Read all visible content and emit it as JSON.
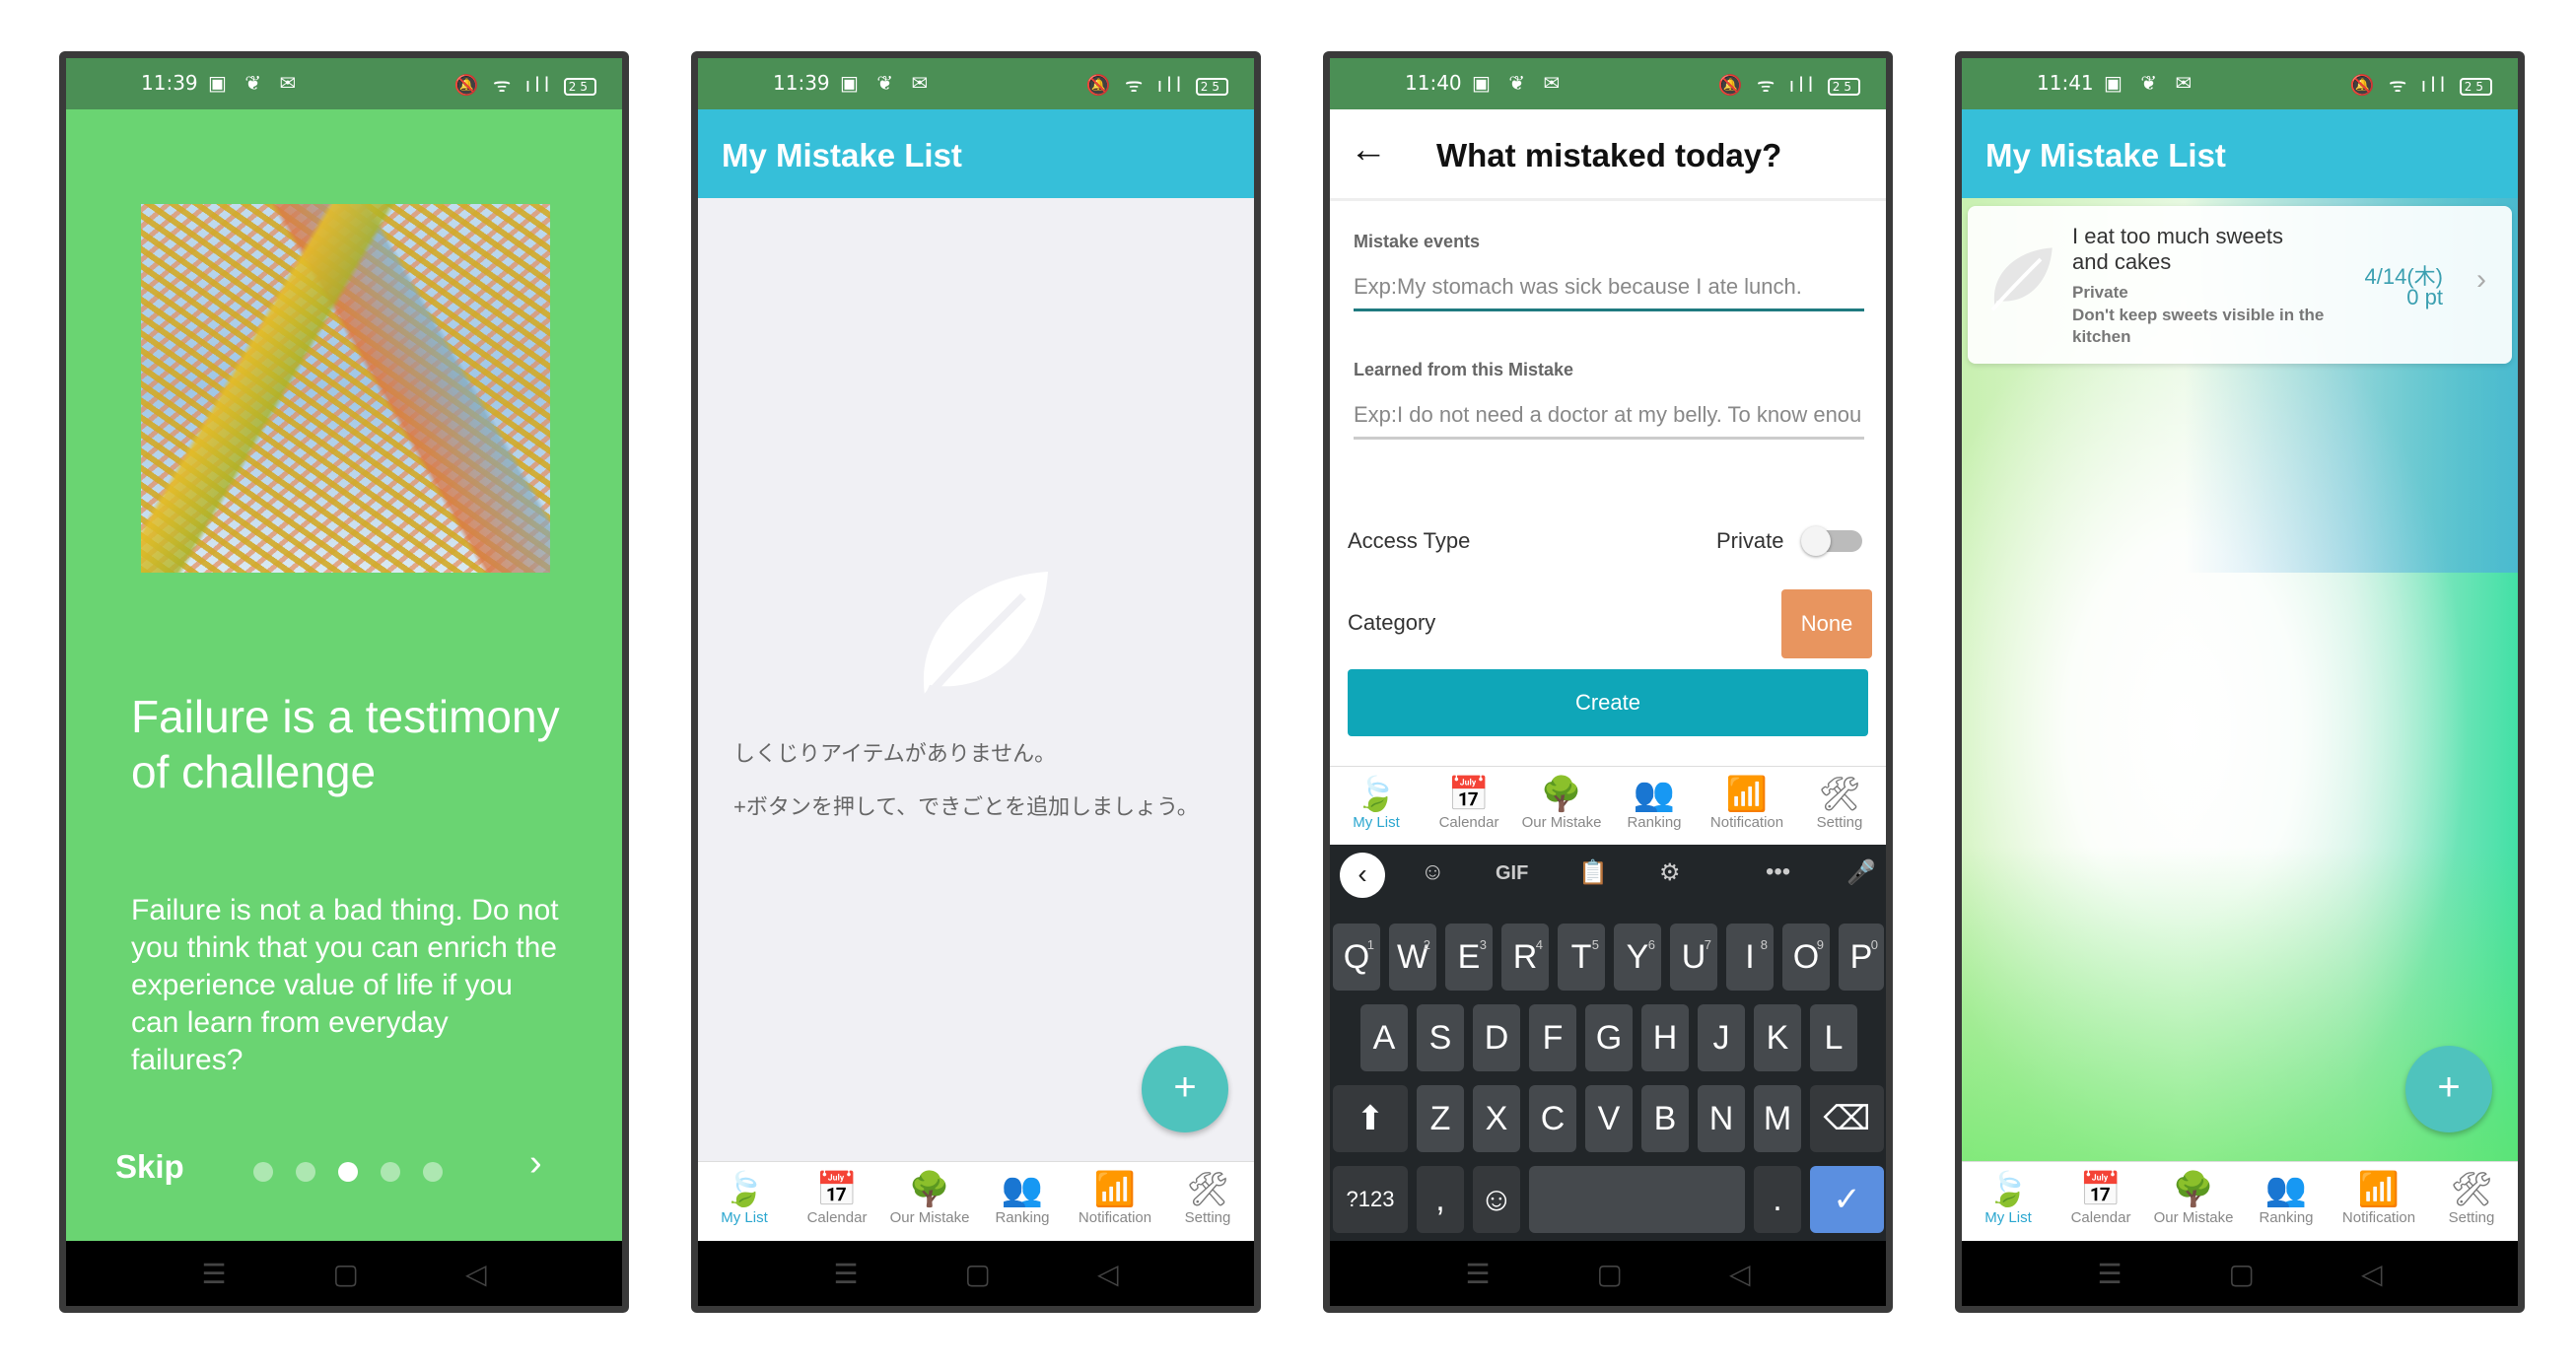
{
  "status": {
    "times": [
      "11:39",
      "11:39",
      "11:40",
      "11:41"
    ],
    "left_icons": "▣ ❦ ✉",
    "right_icons": "🔕 ᯤ ıll",
    "battery": "25"
  },
  "onboarding": {
    "title": "Failure is a testimony of challenge",
    "body": "Failure is not a bad thing. Do not you think that you can enrich the experience value of life if you can learn from everyday failures?",
    "skip_label": "Skip",
    "next_glyph": "›",
    "page_count": 5,
    "active_page": 3
  },
  "list_screen": {
    "title": "My Mistake List",
    "empty_line1": "しくじりアイテムがありません。",
    "empty_line2": "+ボタンを押して、できごとを追加しましょう。",
    "fab_label": "+"
  },
  "tabs": [
    {
      "label": "My List",
      "icon": "leaf-icon",
      "glyph": "🍃"
    },
    {
      "label": "Calendar",
      "icon": "calendar-icon",
      "glyph": "📅"
    },
    {
      "label": "Our Mistake",
      "icon": "tree-icon",
      "glyph": "🌳"
    },
    {
      "label": "Ranking",
      "icon": "people-icon",
      "glyph": "👥"
    },
    {
      "label": "Notification",
      "icon": "wifi-icon",
      "glyph": "📶"
    },
    {
      "label": "Setting",
      "icon": "tools-icon",
      "glyph": "🛠"
    }
  ],
  "form_screen": {
    "title": "What mistaked today?",
    "back_glyph": "←",
    "mistake_label": "Mistake events",
    "mistake_placeholder": "Exp:My stomach was sick because I ate lunch.",
    "learned_label": "Learned from this Mistake",
    "learned_placeholder": "Exp:I do not need a doctor at my belly. To know enou",
    "access_label": "Access Type",
    "access_value": "Private",
    "category_label": "Category",
    "category_value": "None",
    "create_label": "Create"
  },
  "keyboard": {
    "toolbar": [
      "‹",
      "☺",
      "GIF",
      "📋",
      "⚙",
      "•••",
      "🎤"
    ],
    "row1": [
      [
        "Q",
        "1"
      ],
      [
        "W",
        "2"
      ],
      [
        "E",
        "3"
      ],
      [
        "R",
        "4"
      ],
      [
        "T",
        "5"
      ],
      [
        "Y",
        "6"
      ],
      [
        "U",
        "7"
      ],
      [
        "I",
        "8"
      ],
      [
        "O",
        "9"
      ],
      [
        "P",
        "0"
      ]
    ],
    "row2": [
      "A",
      "S",
      "D",
      "F",
      "G",
      "H",
      "J",
      "K",
      "L"
    ],
    "row3": [
      "Z",
      "X",
      "C",
      "V",
      "B",
      "N",
      "M"
    ],
    "shift": "⬆",
    "backspace": "⌫",
    "symbols": "?123",
    "comma": ",",
    "emoji": "☺",
    "period": ".",
    "enter": "✓"
  },
  "filled_list": {
    "title": "My Mistake List",
    "item": {
      "title": "I eat too much sweets and cakes",
      "access": "Private",
      "learned": "Don't keep sweets visible in the kitchen",
      "date": "4/14(木)",
      "points": "0 pt"
    },
    "fab_label": "+"
  },
  "nav_glyphs": [
    "☰",
    "▢",
    "◁"
  ],
  "colors": {
    "status_bar": "#4b8f55",
    "onboarding_bg": "#6ad472",
    "app_bar": "#36bfd9",
    "fab": "#4fc3bd",
    "create_button": "#0fa6b8",
    "category_button": "#e8955f",
    "active_tab": "#2aa6cf"
  }
}
